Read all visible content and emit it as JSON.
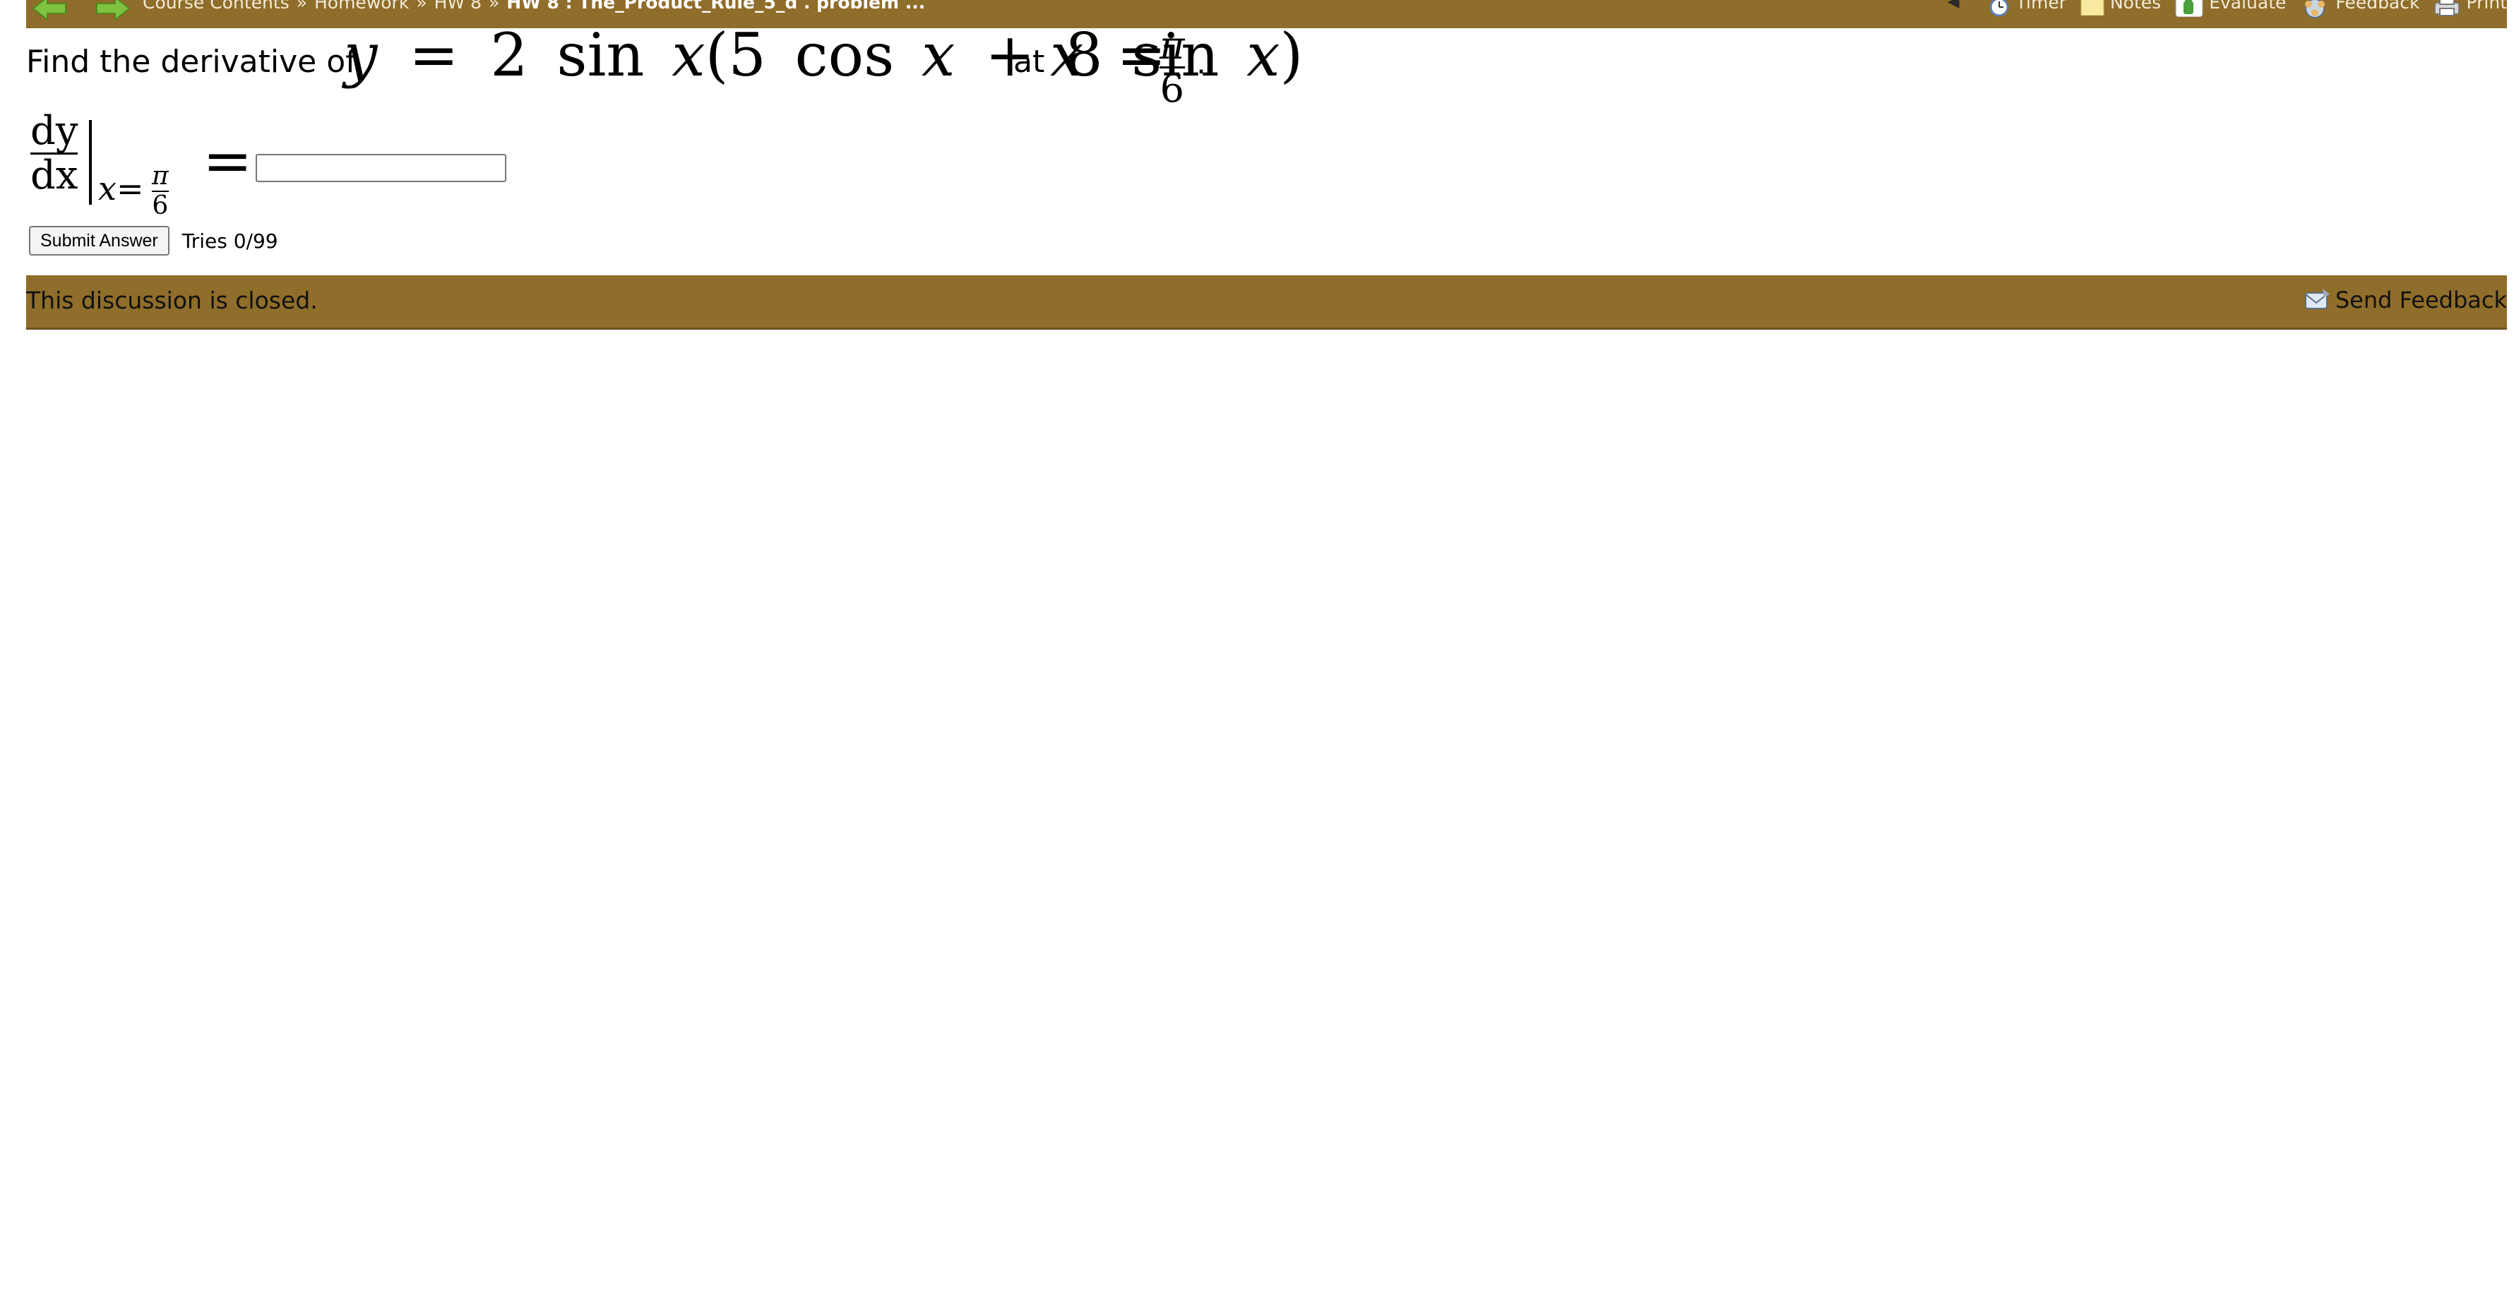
{
  "nav": {
    "back_icon": "back-arrow-icon",
    "forward_icon": "forward-arrow-icon",
    "breadcrumb": [
      "Course Contents",
      "Homework",
      "HW 8"
    ],
    "separator": "»",
    "current": "HW 8 : The_Product_Rule_5_d . problem ...",
    "collapse_glyph": "◀",
    "tools": [
      {
        "label": "Timer",
        "icon": "timer-icon"
      },
      {
        "label": "Notes",
        "icon": "notes-icon"
      },
      {
        "label": "Evaluate",
        "icon": "evaluate-icon"
      },
      {
        "label": "Feedback",
        "icon": "feedback-icon"
      },
      {
        "label": "Print",
        "icon": "print-icon"
      }
    ],
    "bar_color": "#8f6d2a"
  },
  "problem": {
    "prefix": "Find the derivative of",
    "function": {
      "y": "y",
      "eq": "=",
      "coef": "2",
      "sin": "sin",
      "x": "x",
      "open": "(",
      "c1": "5",
      "cos": "cos",
      "plus": "+",
      "c2": "8",
      "close": ")"
    },
    "at": "at",
    "point": {
      "x": "x",
      "eq": "=",
      "num": "π",
      "den": "6"
    },
    "period": "."
  },
  "answer": {
    "dy": "dy",
    "dx": "dx",
    "sub_x": "x",
    "sub_eq": "=",
    "sub_num": "π",
    "sub_den": "6",
    "eq": "=",
    "input_value": "",
    "input_placeholder": ""
  },
  "submit": {
    "label": "Submit Answer",
    "tries": "Tries 0/99"
  },
  "discussion": {
    "closed_text": "This discussion is closed.",
    "send_feedback": "Send Feedback",
    "send_feedback_icon": "send-feedback-icon"
  }
}
